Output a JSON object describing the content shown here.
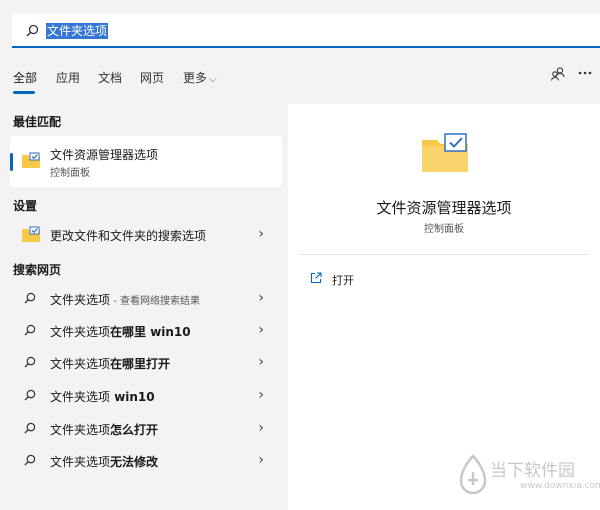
{
  "search": {
    "query": "文件夹选项"
  },
  "tabs": [
    {
      "label": "全部"
    },
    {
      "label": "应用"
    },
    {
      "label": "文档"
    },
    {
      "label": "网页"
    },
    {
      "label": "更多"
    }
  ],
  "sections": {
    "best_match": "最佳匹配",
    "settings": "设置",
    "web": "搜索网页"
  },
  "best_match": {
    "title": "文件资源管理器选项",
    "subtitle": "控制面板",
    "icon": "folder-check-icon"
  },
  "settings_item": {
    "label": "更改文件和文件夹的搜索选项",
    "icon": "folder-check-icon"
  },
  "web_items": [
    {
      "prefix": "文件夹选项",
      "bold": "",
      "hint": " - 查看网络搜索结果"
    },
    {
      "prefix": "文件夹选项",
      "bold": "在哪里 win10",
      "hint": ""
    },
    {
      "prefix": "文件夹选项",
      "bold": "在哪里打开",
      "hint": ""
    },
    {
      "prefix": "文件夹选项",
      "bold": " win10",
      "hint": ""
    },
    {
      "prefix": "文件夹选项",
      "bold": "怎么打开",
      "hint": ""
    },
    {
      "prefix": "文件夹选项",
      "bold": "无法修改",
      "hint": ""
    }
  ],
  "detail": {
    "title": "文件资源管理器选项",
    "subtitle": "控制面板",
    "open_label": "打开"
  },
  "watermark": {
    "text": "当下软件园",
    "url": "www.downxia.com"
  },
  "colors": {
    "accent": "#0067c0",
    "folder": "#f7c948",
    "selection": "#3477d4"
  }
}
